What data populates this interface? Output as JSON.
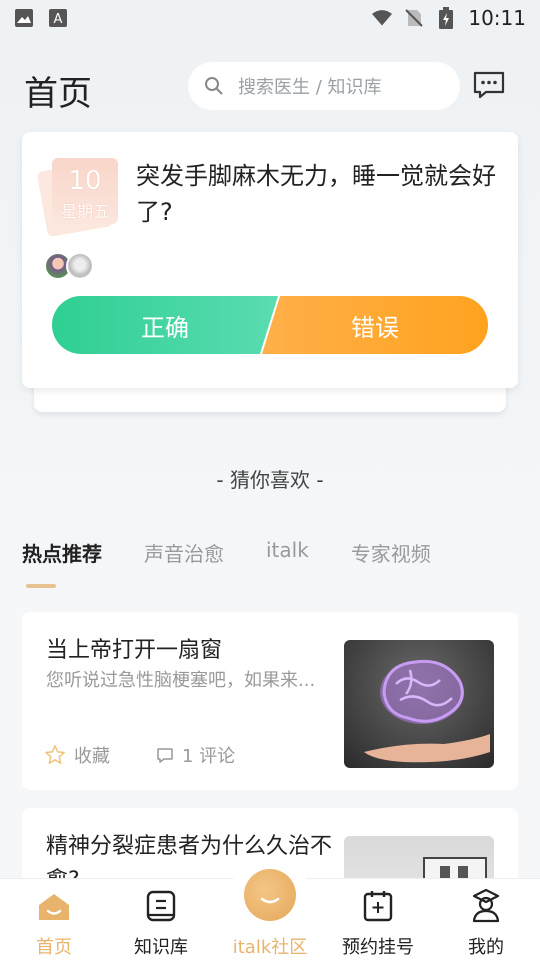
{
  "status": {
    "time": "10:11"
  },
  "header": {
    "title": "首页",
    "search_placeholder": "搜索医生 / 知识库"
  },
  "quiz": {
    "date_day": "10",
    "date_weekday": "星期五",
    "question": "突发手脚麻木无力，睡一觉就会好了?",
    "answer_right": "正确",
    "answer_wrong": "错误"
  },
  "section_title": "- 猜你喜欢 -",
  "tabs": [
    {
      "label": "热点推荐",
      "active": true
    },
    {
      "label": "声音治愈",
      "active": false
    },
    {
      "label": "italk",
      "active": false
    },
    {
      "label": "专家视频",
      "active": false
    }
  ],
  "articles": [
    {
      "title": "当上帝打开一扇窗",
      "summary": "您听说过急性脑梗塞吧，如果来...",
      "favorite_label": "收藏",
      "comment_label": "1 评论"
    },
    {
      "title": "精神分裂症患者为什么久治不愈?",
      "summary": ""
    }
  ],
  "tabbar": [
    {
      "label": "首页",
      "icon": "home-icon",
      "active": true
    },
    {
      "label": "知识库",
      "icon": "book-icon",
      "active": false
    },
    {
      "label": "italk社区",
      "icon": "community-icon",
      "active": false
    },
    {
      "label": "预约挂号",
      "icon": "calendar-icon",
      "active": false
    },
    {
      "label": "我的",
      "icon": "profile-icon",
      "active": false
    }
  ],
  "colors": {
    "accent": "#e8b46c",
    "right_green": "#2fcf93",
    "wrong_orange": "#ffa21e"
  }
}
